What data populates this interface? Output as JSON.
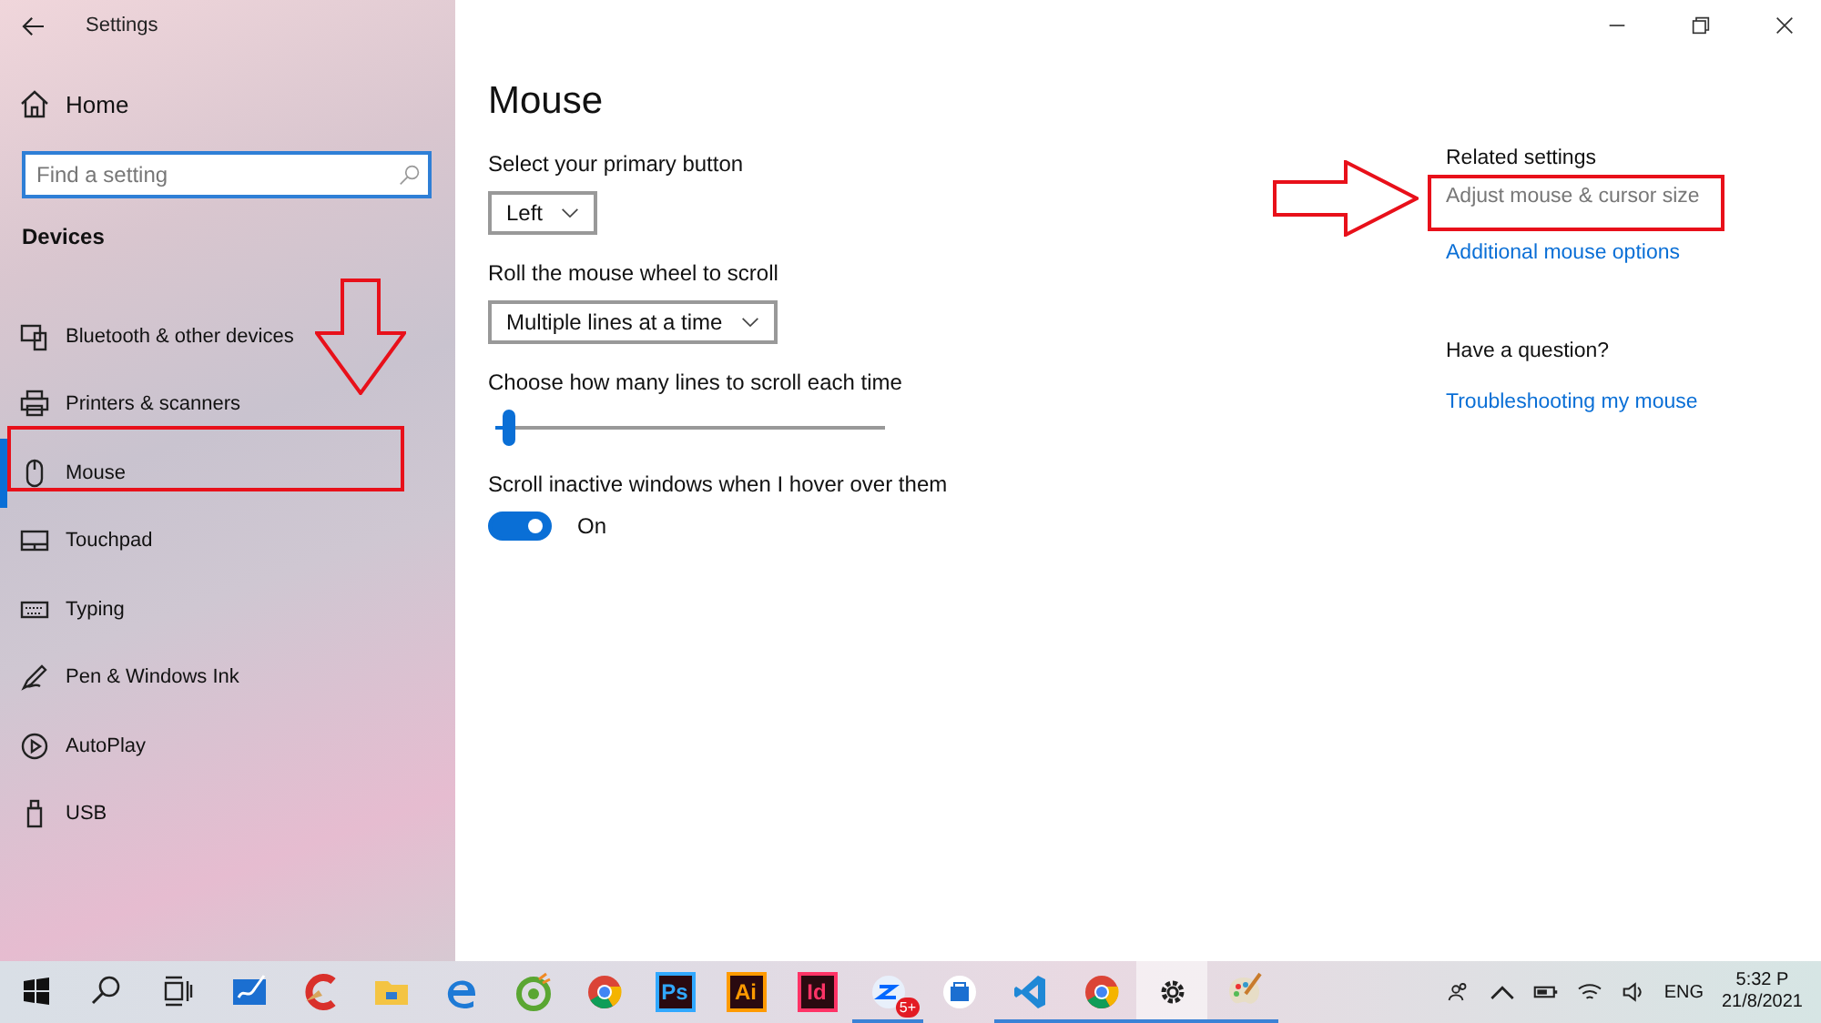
{
  "window": {
    "title": "Settings"
  },
  "sidebar": {
    "home": "Home",
    "search": {
      "placeholder": "Find a setting"
    },
    "section": "Devices",
    "items": [
      {
        "label": "Bluetooth & other devices",
        "kind": "bluetooth",
        "selected": false
      },
      {
        "label": "Printers & scanners",
        "kind": "printer",
        "selected": false
      },
      {
        "label": "Mouse",
        "kind": "mouse",
        "selected": true
      },
      {
        "label": "Touchpad",
        "kind": "touchpad",
        "selected": false
      },
      {
        "label": "Typing",
        "kind": "keyboard",
        "selected": false
      },
      {
        "label": "Pen & Windows Ink",
        "kind": "pen",
        "selected": false
      },
      {
        "label": "AutoPlay",
        "kind": "autoplay",
        "selected": false
      },
      {
        "label": "USB",
        "kind": "usb",
        "selected": false
      }
    ]
  },
  "main": {
    "title": "Mouse",
    "settings": [
      {
        "kind": "dropdown",
        "label": "Select your primary button",
        "value": "Left"
      },
      {
        "kind": "dropdown",
        "label": "Roll the mouse wheel to scroll",
        "value": "Multiple lines at a time"
      },
      {
        "kind": "slider",
        "label": "Choose how many lines to scroll each time",
        "level": 0.03
      },
      {
        "kind": "toggle",
        "label": "Scroll inactive windows when I hover over them",
        "on": true,
        "state_text": "On"
      }
    ]
  },
  "related": {
    "heading": "Related settings",
    "links": [
      {
        "label": "Adjust mouse & cursor size",
        "disabled": true
      },
      {
        "label": "Additional mouse options",
        "disabled": false
      }
    ]
  },
  "help": {
    "heading": "Have a question?",
    "links": [
      {
        "label": "Troubleshooting my mouse",
        "disabled": false
      }
    ]
  },
  "taskbar": {
    "items": [
      {
        "kind": "start",
        "running": false,
        "active": false
      },
      {
        "kind": "search",
        "running": false,
        "active": false
      },
      {
        "kind": "taskview",
        "running": false,
        "active": false
      },
      {
        "kind": "whiteboard",
        "running": false,
        "active": false
      },
      {
        "kind": "cleaner",
        "running": false,
        "active": false
      },
      {
        "kind": "folder",
        "running": false,
        "active": false
      },
      {
        "kind": "edge",
        "running": false,
        "active": false
      },
      {
        "kind": "coccoc",
        "running": false,
        "active": false
      },
      {
        "kind": "chrome",
        "running": false,
        "active": false
      },
      {
        "kind": "tile",
        "label": "Ps",
        "color": "#31a8ff",
        "running": false,
        "active": false
      },
      {
        "kind": "tile",
        "label": "Ai",
        "color": "#ff9a00",
        "running": false,
        "active": false
      },
      {
        "kind": "tile",
        "label": "Id",
        "color": "#ff3366",
        "running": false,
        "active": false
      },
      {
        "kind": "chat",
        "badge": "5+",
        "running": true,
        "active": false
      },
      {
        "kind": "store",
        "running": false,
        "active": false
      },
      {
        "kind": "vscode",
        "running": true,
        "active": false
      },
      {
        "kind": "chrome",
        "running": true,
        "active": false
      },
      {
        "kind": "gear",
        "running": true,
        "active": true
      },
      {
        "kind": "paint",
        "running": true,
        "active": false
      }
    ],
    "tray": {
      "language": "ENG",
      "time": "5:32 P",
      "date": "21/8/2021"
    }
  }
}
